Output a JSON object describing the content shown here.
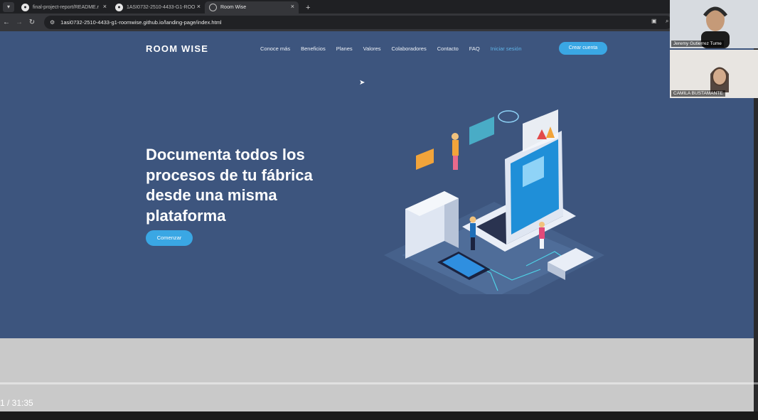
{
  "browser": {
    "tabs": [
      {
        "title": "final-project-report/README.r",
        "active": false,
        "icon": "github-icon"
      },
      {
        "title": "1ASI0732-2510-4433-G1-ROO",
        "active": false,
        "icon": "github-icon"
      },
      {
        "title": "Room Wise",
        "active": true,
        "icon": "globe-icon"
      }
    ],
    "new_tab": "+",
    "url": "1asi0732-2510-4433-g1-roomwise.github.io/landing-page/index.html"
  },
  "site": {
    "brand": "ROOM WISE",
    "nav": [
      "Conoce más",
      "Beneficios",
      "Planes",
      "Valores",
      "Colaboradores",
      "Contacto",
      "FAQ"
    ],
    "login": "Iniciar sesión",
    "create_account": "Crear cuenta",
    "headline": "Documenta todos los procesos de tu fábrica desde una misma plataforma",
    "start": "Comenzar",
    "colors": {
      "background": "#3d557e",
      "accent": "#3aa7e4"
    }
  },
  "video": {
    "timecode": "1 / 31:35",
    "progress": 0.0
  },
  "participants": [
    {
      "name": "Jeremy Gutierrez Tume"
    },
    {
      "name": "CAMILA BUSTAMANTE"
    }
  ]
}
